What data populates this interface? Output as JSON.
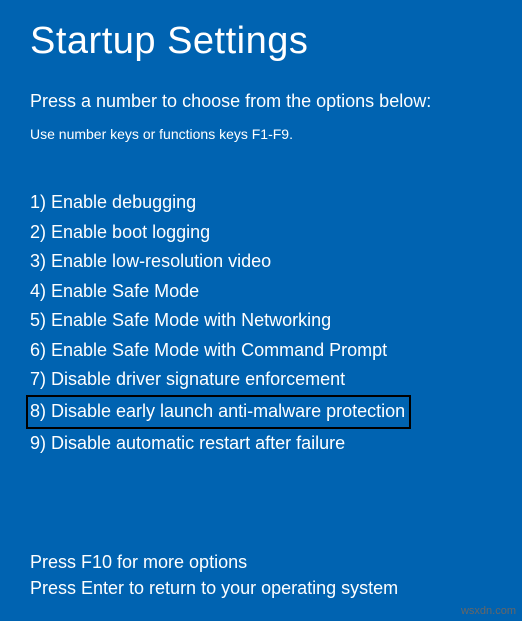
{
  "title": "Startup Settings",
  "subtitle": "Press a number to choose from the options below:",
  "hint": "Use number keys or functions keys F1-F9.",
  "options": [
    {
      "label": "1) Enable debugging",
      "highlighted": false
    },
    {
      "label": "2) Enable boot logging",
      "highlighted": false
    },
    {
      "label": "3) Enable low-resolution video",
      "highlighted": false
    },
    {
      "label": "4) Enable Safe Mode",
      "highlighted": false
    },
    {
      "label": "5) Enable Safe Mode with Networking",
      "highlighted": false
    },
    {
      "label": "6) Enable Safe Mode with Command Prompt",
      "highlighted": false
    },
    {
      "label": "7) Disable driver signature enforcement",
      "highlighted": false
    },
    {
      "label": "8) Disable early launch anti-malware protection",
      "highlighted": true
    },
    {
      "label": "9) Disable automatic restart after failure",
      "highlighted": false
    }
  ],
  "footer": {
    "more": "Press F10 for more options",
    "return": "Press Enter to return to your operating system"
  },
  "watermark": "wsxdn.com"
}
